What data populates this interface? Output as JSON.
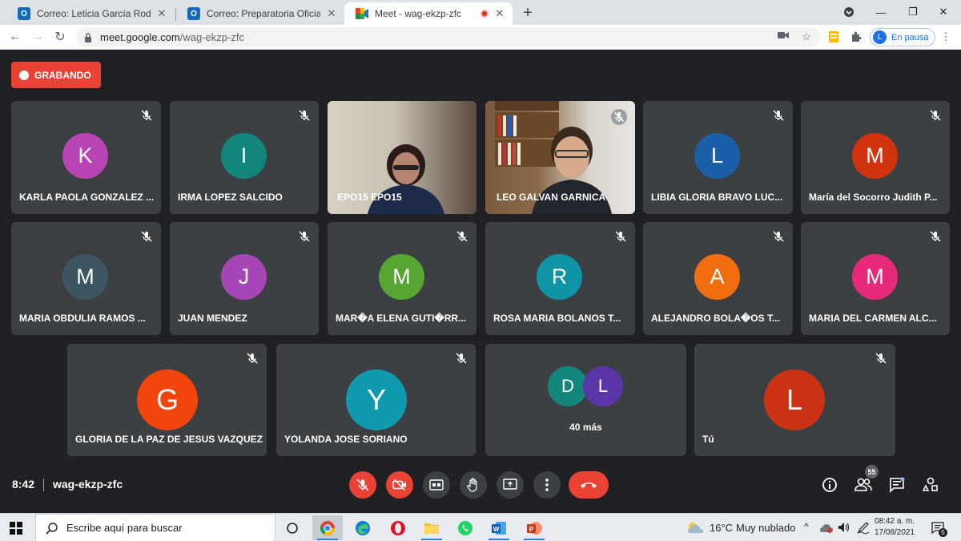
{
  "browser": {
    "tabs": [
      {
        "title": "Correo: Leticia García Rodríguez",
        "icon": "outlook-icon"
      },
      {
        "title": "Correo: Preparatoria Oficial Num",
        "icon": "outlook-icon"
      },
      {
        "title": "Meet - wag-ekzp-zfc",
        "icon": "meet-icon",
        "active": true
      }
    ],
    "url_host": "meet.google.com",
    "url_path": "/wag-ekzp-zfc",
    "profile_initial": "L",
    "profile_status": "En pausa"
  },
  "meet": {
    "recording_label": "GRABANDO",
    "participants_row1": [
      {
        "initial": "K",
        "name": "KARLA PAOLA GONZALEZ ...",
        "color": "#b944b5",
        "muted": true
      },
      {
        "initial": "I",
        "name": "IRMA LOPEZ SALCIDO",
        "color": "#12867b",
        "muted": true
      },
      {
        "initial": "",
        "name": "EPO15 EPO15",
        "color": "",
        "muted": false,
        "video": true
      },
      {
        "initial": "",
        "name": "LEO GALVAN GARNICA",
        "color": "",
        "muted": true,
        "video": true
      },
      {
        "initial": "L",
        "name": "LIBIA GLORIA BRAVO LUC...",
        "color": "#1a5fa8",
        "muted": true
      },
      {
        "initial": "M",
        "name": "María del Socorro Judith P...",
        "color": "#d0330d",
        "muted": true
      }
    ],
    "participants_row2": [
      {
        "initial": "M",
        "name": "MARIA OBDULIA RAMOS ...",
        "color": "#3d5561",
        "muted": true
      },
      {
        "initial": "J",
        "name": "JUAN MENDEZ",
        "color": "#a645b5",
        "muted": true
      },
      {
        "initial": "M",
        "name": "MAR�A ELENA GUTI�RR...",
        "color": "#57a532",
        "muted": true
      },
      {
        "initial": "R",
        "name": "ROSA MARIA BOLANOS T...",
        "color": "#0f94a6",
        "muted": true
      },
      {
        "initial": "A",
        "name": "ALEJANDRO BOLA�OS T...",
        "color": "#f26d0e",
        "muted": true
      },
      {
        "initial": "M",
        "name": "MARIA DEL CARMEN ALC...",
        "color": "#e62a79",
        "muted": true
      }
    ],
    "participants_row3": [
      {
        "initial": "G",
        "name": "GLORIA DE LA PAZ DE JESUS VAZQUEZ",
        "color": "#f2450b",
        "muted": true
      },
      {
        "initial": "Y",
        "name": "YOLANDA JOSE SORIANO",
        "color": "#0f9ab0",
        "muted": true
      }
    ],
    "more": {
      "initials": [
        "D",
        "L"
      ],
      "colors": [
        "#12867b",
        "#5b36a9"
      ],
      "label": "40 más"
    },
    "self": {
      "initial": "L",
      "name": "Tú",
      "color": "#cc3314",
      "muted": true
    },
    "time": "8:42",
    "code": "wag-ekzp-zfc",
    "people_count": "55"
  },
  "taskbar": {
    "search_placeholder": "Escribe aquí para buscar",
    "weather_temp": "16°C",
    "weather_desc": "Muy nublado",
    "time": "08:42 a. m.",
    "date": "17/08/2021",
    "notifications": "5"
  }
}
